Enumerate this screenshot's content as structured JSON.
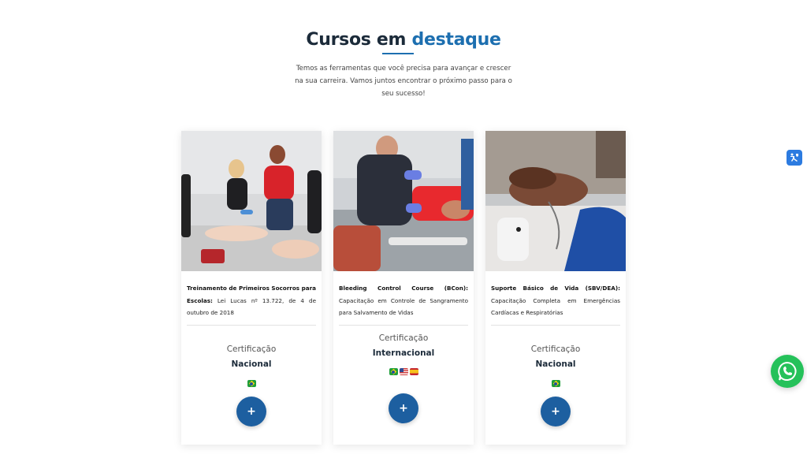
{
  "section": {
    "title_main": "Cursos em ",
    "title_accent": "destaque",
    "subtitle": "Temos as ferramentas que você precisa para avançar e crescer na sua carreira. Vamos juntos encontrar o próximo passo para o seu sucesso!"
  },
  "courses": [
    {
      "title": "Treinamento de Primeiros Socorros para Escolas:",
      "detail": " Lei Lucas nº 13.722, de 4 de outubro de 2018",
      "cert_label": "Certificação",
      "cert_type": "Nacional",
      "flags": [
        "brazil-flag-icon"
      ],
      "button_label": "+"
    },
    {
      "title": "Bleeding Control Course (BCon):",
      "detail": " Capacitação em Controle de Sangramento para Salvamento de Vidas",
      "cert_label": "Certificação",
      "cert_type": "Internacional",
      "flags": [
        "brazil-flag-icon",
        "usa-flag-icon",
        "spain-flag-icon"
      ],
      "button_label": "+"
    },
    {
      "title": "Suporte Básico de Vida (SBV/DEA):",
      "detail": " Capacitação Completa em Emergências Cardíacas e Respiratórias",
      "cert_label": "Certificação",
      "cert_type": "Nacional",
      "flags": [
        "brazil-flag-icon"
      ],
      "button_label": "+"
    }
  ],
  "widgets": {
    "accessibility_icon": "accessibility-hand-icon",
    "whatsapp_icon": "whatsapp-icon"
  },
  "colors": {
    "accent": "#1d6fb0",
    "button": "#1d5fa0",
    "whatsapp": "#25c15a",
    "heading": "#1c2b3a"
  }
}
